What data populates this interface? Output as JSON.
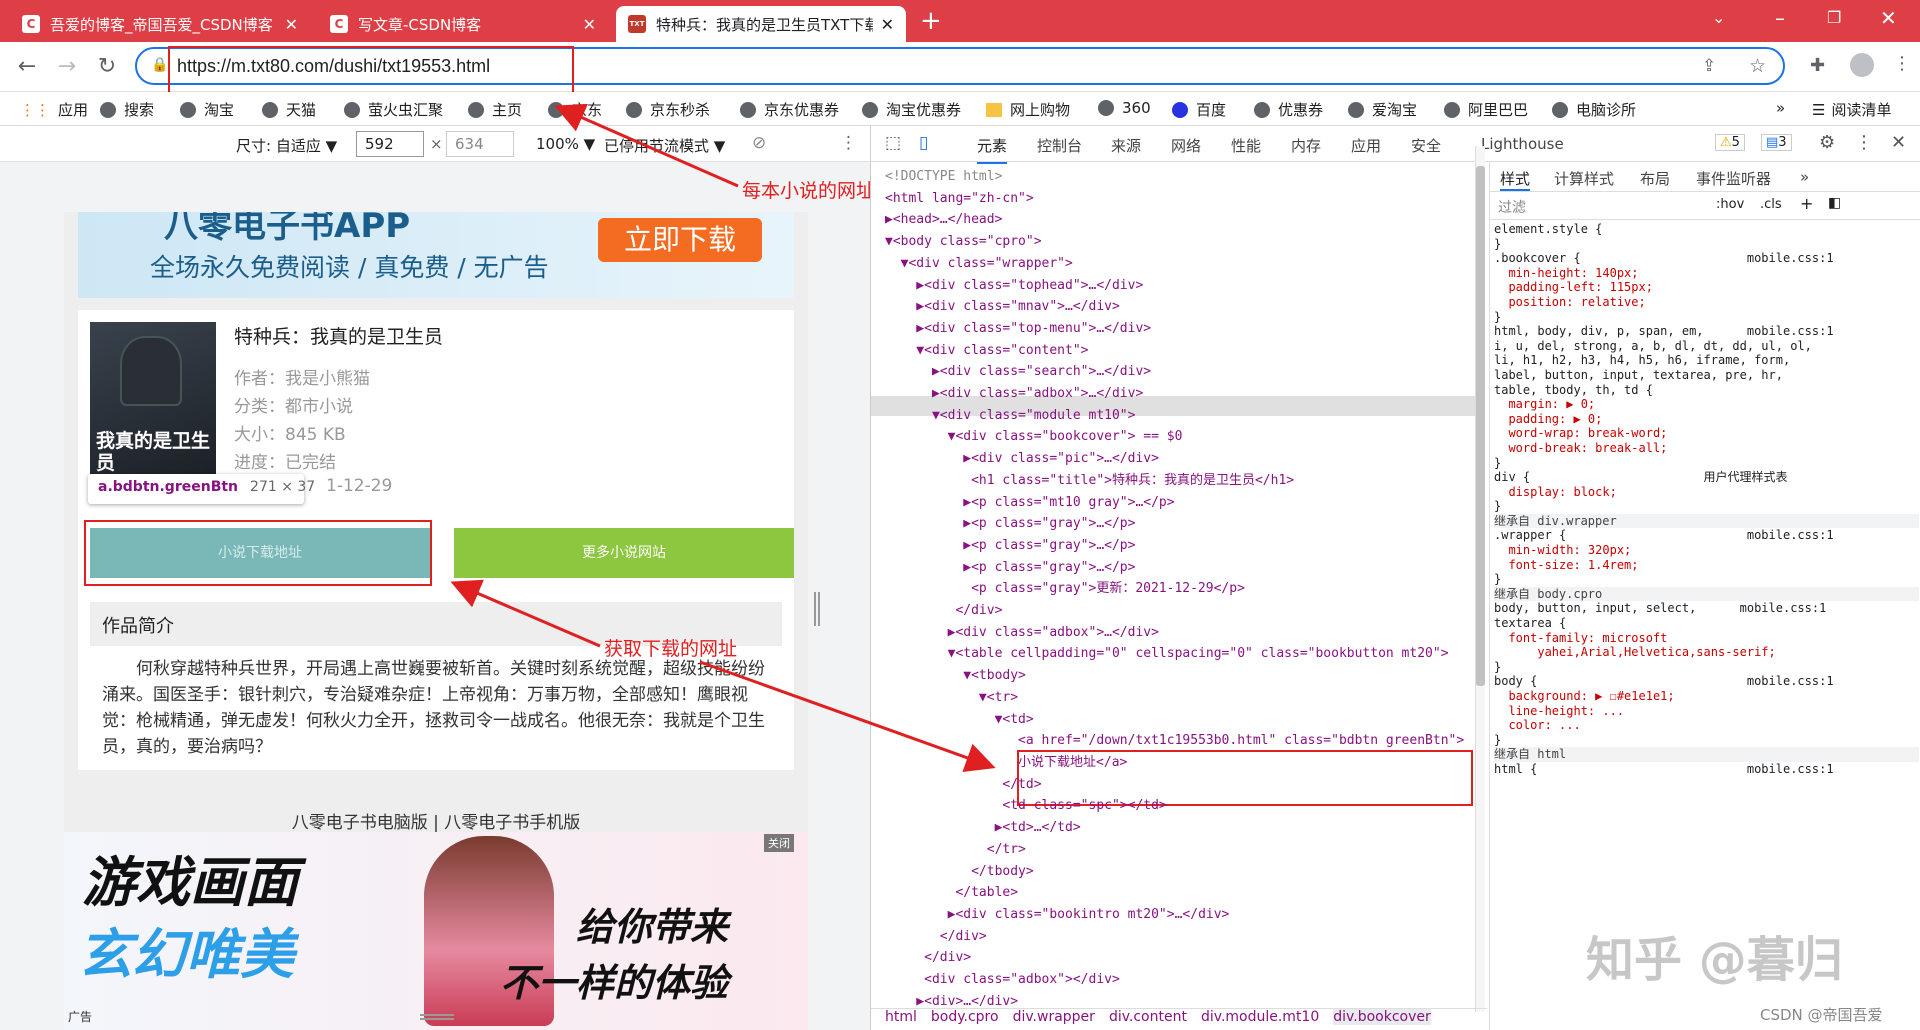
{
  "tabs": [
    {
      "label": "吾爱的博客_帝国吾爱_CSDN博客",
      "icon": "C",
      "close": "✕"
    },
    {
      "label": "写文章-CSDN博客",
      "icon": "C",
      "close": "✕"
    },
    {
      "label": "特种兵：我真的是卫生员TXT下载",
      "icon": "TXT",
      "close": "✕"
    }
  ],
  "new_tab": "+",
  "url": "https://m.txt80.com/dushi/txt19553.html",
  "bookmarks": [
    "应用",
    "搜索",
    "淘宝",
    "天猫",
    "萤火虫汇聚",
    "主页",
    "京东",
    "京东秒杀",
    "京东优惠券",
    "淘宝优惠券",
    "网上购物",
    "360",
    "百度",
    "优惠券",
    "爱淘宝",
    "阿里巴巴",
    "电脑诊所"
  ],
  "bookmarks_more": "»",
  "reading_list": "阅读清单",
  "device_bar": {
    "size_label": "尺寸: 自适应 ▼",
    "width": "592",
    "times": "×",
    "height": "634",
    "zoom": "100% ▼",
    "throttle": "已停用节流模式 ▼"
  },
  "annotations": {
    "url": "每本小说的网址",
    "download": "获取下载的网址"
  },
  "site": {
    "banner_title": "八零电子书APP",
    "banner_sub": "全场永久免费阅读 / 真免费 / 无广告",
    "banner_btn": "立即下载",
    "book_title": "特种兵：我真的是卫生员",
    "author": "作者：我是小熊猫",
    "category": "分类：都市小说",
    "size": "大小：845 KB",
    "progress": "进度：已完结",
    "updated": "1-12-29",
    "cover_text": "我真的是卫生员",
    "tooltip_name": "a.bdbtn.greenBtn",
    "tooltip_size": "271 × 37",
    "download_btn": "小说下载地址",
    "more_btn": "更多小说网站",
    "intro_heading": "作品简介",
    "intro": "何秋穿越特种兵世界，开局遇上高世巍要被斩首。关键时刻系统觉醒，超级技能纷纷涌来。国医圣手：银针刺穴，专治疑难杂症！上帝视角：万事万物，全部感知！鹰眼视觉：枪械精通，弹无虚发！何秋火力全开，拯救司令一战成名。他很无奈：我就是个卫生员，真的，要治病吗？",
    "footer_links": "八零电子书电脑版  |  八零电子书手机版",
    "ad_line1": "游戏画面",
    "ad_line2": "玄幻唯美",
    "ad_right1": "给你带来",
    "ad_right2": "不一样的体验",
    "ad_label": "广告",
    "ad_close": "关闭"
  },
  "devtools": {
    "tabs": [
      "元素",
      "控制台",
      "来源",
      "网络",
      "性能",
      "内存",
      "应用",
      "安全",
      "Lighthouse"
    ],
    "warn_count": "5",
    "msg_count": "3",
    "dom": [
      "<!DOCTYPE html>",
      "<html lang=\"zh-cn\">",
      "▶<head>…</head>",
      "▼<body class=\"cpro\">",
      "  ▼<div class=\"wrapper\">",
      "    ▶<div class=\"tophead\">…</div>",
      "    ▶<div class=\"mnav\">…</div>",
      "    ▶<div class=\"top-menu\">…</div>",
      "    ▼<div class=\"content\">",
      "      ▶<div class=\"search\">…</div>",
      "      ▶<div class=\"adbox\">…</div>",
      "      ▼<div class=\"module mt10\">",
      "        ▼<div class=\"bookcover\"> == $0",
      "          ▶<div class=\"pic\">…</div>",
      "           <h1 class=\"title\">特种兵：我真的是卫生员</h1>",
      "          ▶<p class=\"mt10 gray\">…</p>",
      "          ▶<p class=\"gray\">…</p>",
      "          ▶<p class=\"gray\">…</p>",
      "          ▶<p class=\"gray\">…</p>",
      "           <p class=\"gray\">更新：2021-12-29</p>",
      "         </div>",
      "        ▶<div class=\"adbox\">…</div>",
      "        ▼<table cellpadding=\"0\" cellspacing=\"0\" class=\"bookbutton mt20\">",
      "          ▼<tbody>",
      "            ▼<tr>",
      "              ▼<td>",
      "                 <a href=\"/down/txt1c19553b0.html\" class=\"bdbtn greenBtn\">",
      "                 小说下载地址</a>",
      "               </td>",
      "               <td class=\"spc\"></td>",
      "              ▶<td>…</td>",
      "             </tr>",
      "           </tbody>",
      "         </table>",
      "        ▶<div class=\"bookintro mt20\">…</div>",
      "       </div>",
      "     </div>",
      "     <div class=\"adbox\"></div>",
      "    ▶<div>…</div>"
    ],
    "breadcrumbs": [
      "html",
      "body.cpro",
      "div.wrapper",
      "div.content",
      "div.module.mt10",
      "div.bookcover"
    ],
    "side_tabs": [
      "样式",
      "计算样式",
      "布局",
      "事件监听器",
      "»"
    ],
    "filter_placeholder": "过滤",
    "hov": ":hov",
    "cls": ".cls",
    "styles": [
      "element.style {",
      "}",
      ".bookcover {                       mobile.css:1",
      "  min-height: 140px;",
      "  padding-left: 115px;",
      "  position: relative;",
      "}",
      "html, body, div, p, span, em,      mobile.css:1",
      "i, u, del, strong, a, b, dl, dt, dd, ul, ol,",
      "li, h1, h2, h3, h4, h5, h6, iframe, form,",
      "label, button, input, textarea, pre, hr,",
      "table, tbody, th, td {",
      "  margin: ▶ 0;",
      "  padding: ▶ 0;",
      "  word-wrap: break-word;",
      "  word-break: break-all;",
      "}",
      "div {                        用户代理样式表",
      "  display: block;",
      "}",
      "继承自 div.wrapper",
      ".wrapper {                         mobile.css:1",
      "  min-width: 320px;",
      "  font-size: 1.4rem;",
      "}",
      "继承自 body.cpro",
      "body, button, input, select,      mobile.css:1",
      "textarea {",
      "  font-family: microsoft",
      "      yahei,Arial,Helvetica,sans-serif;",
      "}",
      "body {                             mobile.css:1",
      "  background: ▶ ☐#e1e1e1;",
      "  line-height: ...",
      "  color: ...",
      "}",
      "继承自 html",
      "html {                             mobile.css:1"
    ]
  },
  "watermark": "知乎 @暮归",
  "csdn_mark": "CSDN @帝国吾爱"
}
